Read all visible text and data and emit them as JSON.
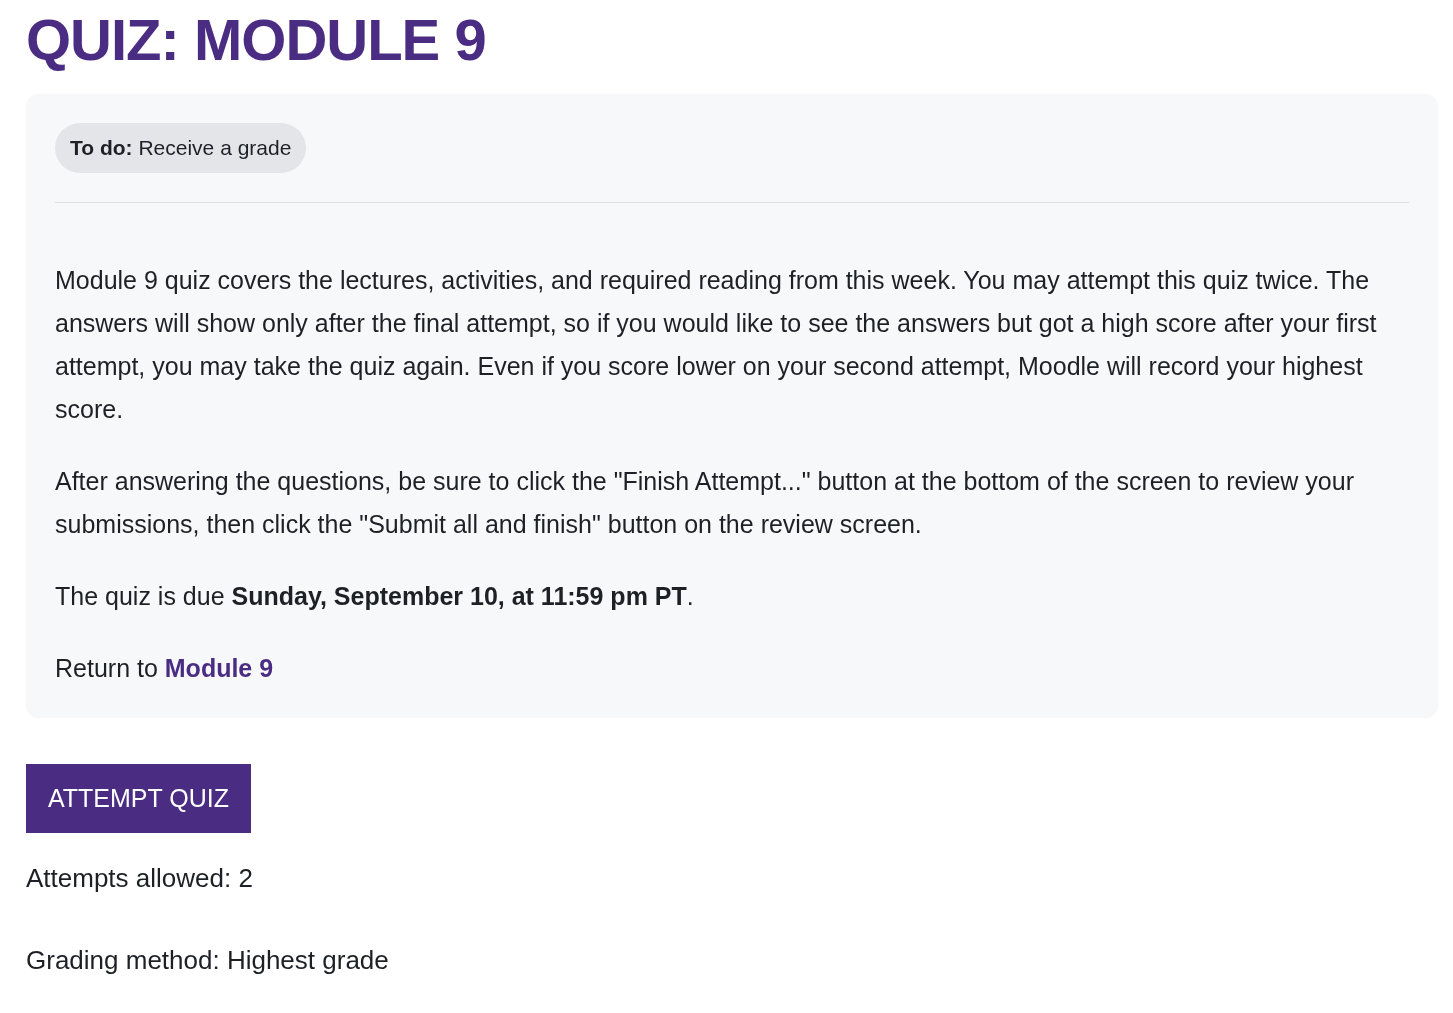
{
  "title": "QUIZ: MODULE 9",
  "todo": {
    "label": "To do:",
    "text": "Receive a grade"
  },
  "paragraphs": [
    "Module 9 quiz covers the lectures, activities, and required reading from this week. You may attempt this quiz twice. The answers will show only after the final attempt, so if you would like to see the answers but got a high score after your first attempt, you may take the quiz again. Even if you score lower on your second attempt, Moodle will record your highest score.",
    "After answering the questions, be sure to click the \"Finish Attempt...\" button at the bottom of the screen to review your submissions, then click the \"Submit all and finish\" button on the review screen.",
    "The quiz is due **Sunday, September 10, at 11:59 pm PT**."
  ],
  "return_line": {
    "text": "Return to",
    "link": "Module 9"
  },
  "button": "ATTEMPT QUIZ",
  "info": [
    "Attempts allowed: 2",
    "Grading method: Highest grade"
  ]
}
